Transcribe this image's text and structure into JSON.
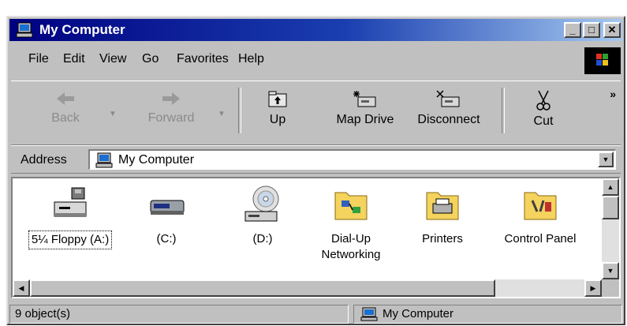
{
  "window": {
    "title": "My Computer"
  },
  "title_buttons": {
    "minimize": "_",
    "maximize": "□",
    "close": "✕"
  },
  "menu": [
    {
      "label": "File"
    },
    {
      "label": "Edit"
    },
    {
      "label": "View"
    },
    {
      "label": "Go"
    },
    {
      "label": "Favorites"
    },
    {
      "label": "Help"
    }
  ],
  "toolbar": {
    "back": {
      "label": "Back",
      "icon": "back-arrow-icon",
      "enabled": false
    },
    "forward": {
      "label": "Forward",
      "icon": "forward-arrow-icon",
      "enabled": false
    },
    "up": {
      "label": "Up",
      "icon": "up-folder-icon",
      "enabled": true
    },
    "map_drive": {
      "label": "Map Drive",
      "icon": "map-drive-icon",
      "enabled": true
    },
    "disconnect": {
      "label": "Disconnect",
      "icon": "disconnect-drive-icon",
      "enabled": true
    },
    "cut": {
      "label": "Cut",
      "icon": "scissors-icon",
      "enabled": true
    },
    "more": "»"
  },
  "address": {
    "label": "Address",
    "value": "My Computer",
    "icon": "my-computer-icon"
  },
  "items": [
    {
      "label": "5¼ Floppy (A:)",
      "icon": "floppy-drive-icon",
      "focused": true
    },
    {
      "label": "(C:)",
      "icon": "hard-drive-icon",
      "focused": false
    },
    {
      "label": "(D:)",
      "icon": "cd-drive-icon",
      "focused": false
    },
    {
      "label": "Dial-Up Networking",
      "icon": "dialup-folder-icon",
      "focused": false
    },
    {
      "label": "Printers",
      "icon": "printers-folder-icon",
      "focused": false
    },
    {
      "label": "Control Panel",
      "icon": "control-panel-folder-icon",
      "focused": false
    }
  ],
  "status": {
    "left": "9 object(s)",
    "right": "My Computer"
  },
  "colors": {
    "titlebar_start": "#000080",
    "titlebar_end": "#a6caf0",
    "chrome": "#c0c0c0",
    "folder": "#f4d35e"
  }
}
